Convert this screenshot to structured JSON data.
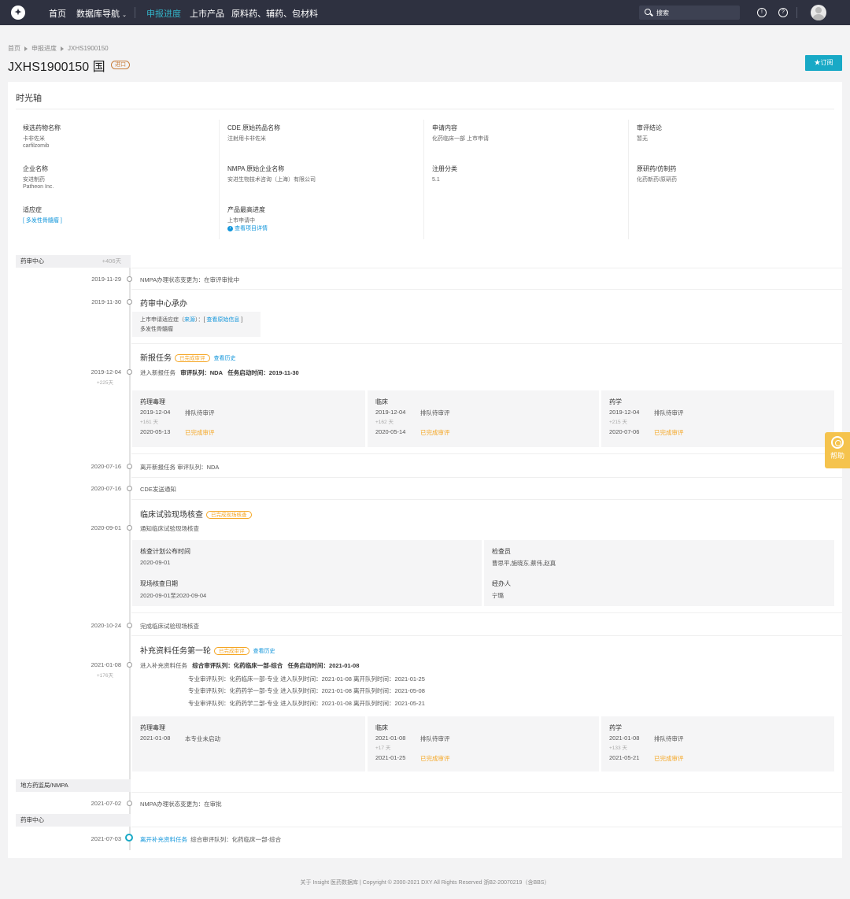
{
  "topnav": {
    "items": [
      "首页",
      "数据库导航",
      "申报进度",
      "上市产品",
      "原料药、辅药、包材料"
    ],
    "search_placeholder": "搜索"
  },
  "breadcrumb": [
    "首页",
    "申报进度",
    "JXHS1900150"
  ],
  "title": "JXHS1900150 国",
  "import_badge": "进口",
  "subscribe": "★订阅",
  "card_title": "时光轴",
  "info": {
    "drug_name_label": "候选药物名称",
    "drug_name_cn": "卡非佐米",
    "drug_name_en": "carfilzomib",
    "cde_name_label": "CDE 原始药品名称",
    "cde_name": "注射用卡非佐米",
    "apply_label": "申请内容",
    "apply_value": "化药临床一部 上市申请",
    "conclusion_label": "审评结论",
    "conclusion_value": "暂无",
    "company_label": "企业名称",
    "company_cn": "安进制药",
    "company_en": "Patheon Inc.",
    "nmpa_company_label": "NMPA 原始企业名称",
    "nmpa_company": "安进生物技术咨询（上海）有限公司",
    "reg_label": "注册分类",
    "reg_value": "5.1",
    "origin_label": "原研药/仿制药",
    "origin_value": "化药新药/原研药",
    "indication_label": "适应症",
    "indication_value": "[ 多发性骨髓瘤 ]",
    "progress_label": "产品最高进度",
    "progress_value": "上市申请中",
    "progress_link": "查看项目详情"
  },
  "sections": {
    "cde": "药审中心",
    "cde_days": "+406天",
    "local": "地方药监局/NMPA",
    "cde2": "药审中心"
  },
  "events": {
    "e1_date": "2019-11-29",
    "e1_text": "NMPA办理状态变更为：在审评审批中",
    "e2_date": "2019-11-30",
    "e2_title": "药审中心承办",
    "e2_box_line1": "上市申请适应症（",
    "e2_box_src": "来源",
    "e2_box_mid": "）：[ ",
    "e2_box_link": "查看原始信息",
    "e2_box_end": " ]",
    "e2_box_line2": "多发性骨髓瘤",
    "task_title": "新报任务",
    "task_tag": "已完成审评",
    "task_hist": "查看历史",
    "e3_date": "2019-12-04",
    "e3_sub": "+225天",
    "e3_text_a": "进入新报任务",
    "e3_text_b": "审评队列：NDA",
    "e3_text_c": "任务启动时间：2019-11-30",
    "e4_date": "2020-07-16",
    "e4_text": "离开新报任务  审评队列：NDA",
    "e5_date": "2020-07-16",
    "e5_text": "CDE发送通知",
    "insp_title": "临床试验现场核查",
    "insp_tag": "已完成现场核查",
    "e6_date": "2020-09-01",
    "e6_text": "通知临床试验现场核查",
    "e7_date": "2020-10-24",
    "e7_text": "完成临床试验现场核查",
    "supp_title": "补充资料任务第一轮",
    "supp_tag": "已完成审评",
    "supp_hist": "查看历史",
    "e8_date": "2021-01-08",
    "e8_sub": "+176天",
    "e8_text_a": "进入补充资料任务",
    "e8_text_b": "综合审评队列：化药临床一部-综合",
    "e8_text_c": "任务启动时间：2021-01-08",
    "e8_q1": "专业审评队列：化药临床一部-专业  进入队列时间：2021-01-08  离开队列时间：2021-01-25",
    "e8_q2": "专业审评队列：化药药学一部-专业  进入队列时间：2021-01-08  离开队列时间：2021-05-08",
    "e8_q3": "专业审评队列：化药药学二部-专业  进入队列时间：2021-01-08  离开队列时间：2021-05-21",
    "e9_date": "2021-07-02",
    "e9_text": "NMPA办理状态变更为：在审批",
    "e10_date": "2021-07-03",
    "e10_link": "离开补充资料任务",
    "e10_text": "综合审评队列：化药临床一部-综合"
  },
  "task_boxes": [
    {
      "title": "药理毒理",
      "d1": "2019-12-04",
      "s1": "排队待审评",
      "plus": "+161 天",
      "d2": "2020-05-13",
      "s2": "已完成审评"
    },
    {
      "title": "临床",
      "d1": "2019-12-04",
      "s1": "排队待审评",
      "plus": "+162 天",
      "d2": "2020-05-14",
      "s2": "已完成审评"
    },
    {
      "title": "药学",
      "d1": "2019-12-04",
      "s1": "排队待审评",
      "plus": "+215 天",
      "d2": "2020-07-06",
      "s2": "已完成审评"
    }
  ],
  "inspection": {
    "plan_label": "核查计划公布时间",
    "plan_value": "2020-09-01",
    "inspector_label": "检查员",
    "inspector_value": "曹思平,施晓东,蔡伟,赵真",
    "site_label": "现场核查日期",
    "site_value": "2020-09-01至2020-09-04",
    "handler_label": "经办人",
    "handler_value": "宁璐"
  },
  "supp_boxes": [
    {
      "title": "药理毒理",
      "d1": "2021-01-08",
      "s1": "本专业未启动"
    },
    {
      "title": "临床",
      "d1": "2021-01-08",
      "s1": "排队待审评",
      "plus": "+17 天",
      "d2": "2021-01-25",
      "s2": "已完成审评"
    },
    {
      "title": "药学",
      "d1": "2021-01-08",
      "s1": "排队待审评",
      "plus": "+133 天",
      "d2": "2021-05-21",
      "s2": "已完成审评"
    }
  ],
  "help": "帮助",
  "footer": "关于 Insight 医药数据库  |  Copyright © 2000-2021 DXY All Rights Reserved  浙B2-20070219（含BBS）",
  "colors": {
    "topbar": "#2e3140",
    "accent": "#18a9c6",
    "link": "#1296db",
    "warning": "#f5a623"
  }
}
